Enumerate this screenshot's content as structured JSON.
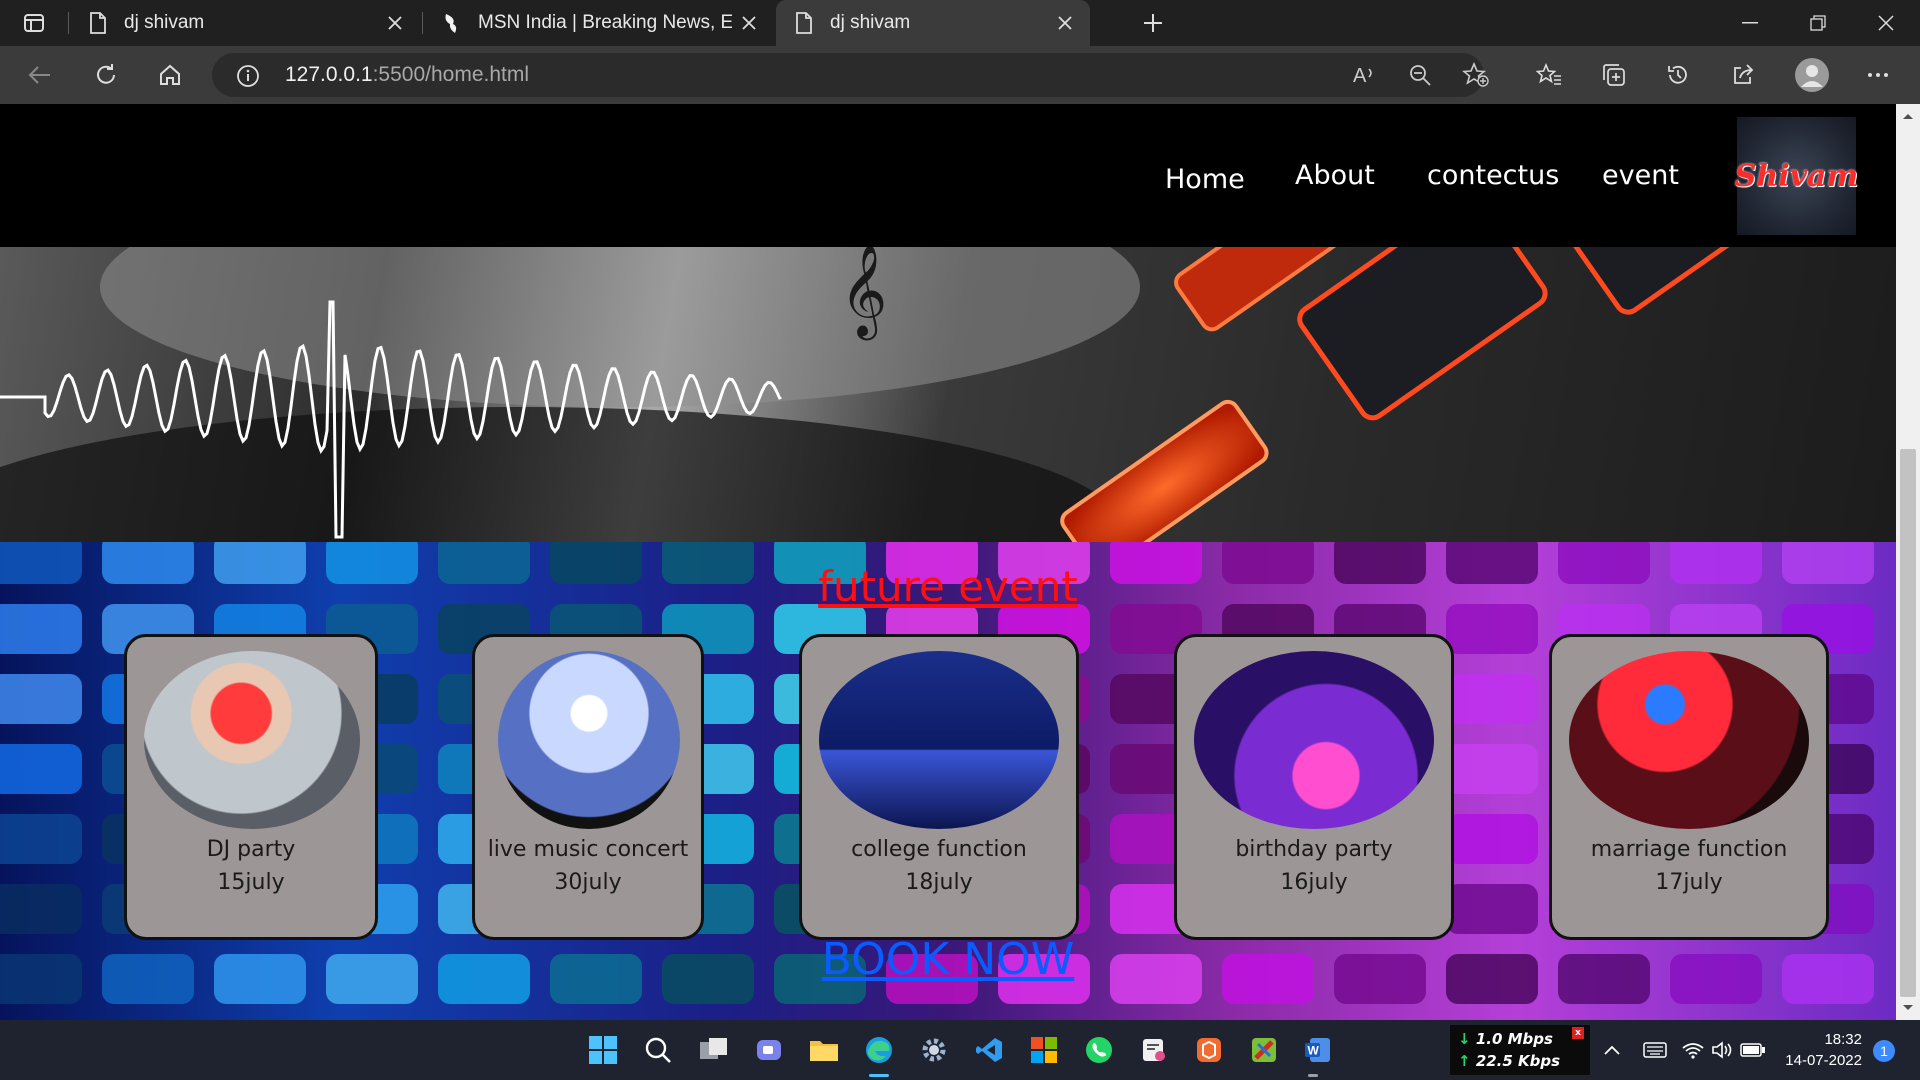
{
  "browser": {
    "tabs": [
      {
        "title": "dj shivam",
        "icon": "page-icon",
        "active": false
      },
      {
        "title": "MSN India | Breaking News, Ente",
        "icon": "msn-butterfly-icon",
        "active": false
      },
      {
        "title": "dj shivam",
        "icon": "page-icon",
        "active": true
      }
    ],
    "address": {
      "host": "127.0.0.1",
      "rest": ":5500/home.html"
    }
  },
  "site": {
    "nav": [
      "Home",
      "About",
      "contectus",
      "event"
    ],
    "logo_text": "Shivam"
  },
  "events": {
    "title": "future event",
    "cards": [
      {
        "name": "DJ party",
        "date": "15july"
      },
      {
        "name": "live music concert",
        "date": "30july"
      },
      {
        "name": "college function",
        "date": "18july"
      },
      {
        "name": "birthday party",
        "date": "16july"
      },
      {
        "name": "marriage function",
        "date": "17july"
      }
    ],
    "book_label": "BOOK NOW"
  },
  "taskbar": {
    "net_down": "1.0 Mbps",
    "net_up": "22.5 Kbps",
    "time": "18:32",
    "date": "14-07-2022",
    "notifications": "1"
  },
  "colors": {
    "events_title": "#ff1010",
    "book_now": "#0b5cff",
    "card_bg": "#9c9696"
  }
}
